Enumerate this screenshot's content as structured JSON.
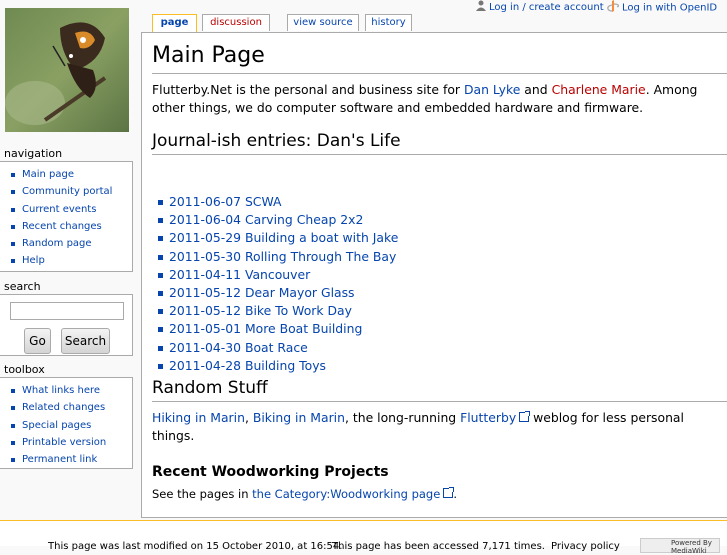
{
  "personal_tools": {
    "login_label": "Log in / create account",
    "openid_label": "Log in with OpenID"
  },
  "tabs": [
    {
      "label": "page"
    },
    {
      "label": "discussion"
    },
    {
      "label": "view source"
    },
    {
      "label": "history"
    }
  ],
  "page": {
    "title": "Main Page",
    "intro": {
      "before": "Flutterby.Net is the personal and business site for ",
      "link1": "Dan Lyke",
      "middle": " and ",
      "link2": "Charlene Marie",
      "after": ". Among other things, we do computer software and embedded hardware and firmware."
    },
    "journal_heading": "Journal-ish entries: Dan's Life",
    "journal_entries": [
      "2011-06-07 SCWA",
      "2011-06-04 Carving Cheap 2x2",
      "2011-05-29 Building a boat with Jake",
      "2011-05-30 Rolling Through The Bay",
      "2011-04-11 Vancouver",
      "2011-05-12 Dear Mayor Glass",
      "2011-05-12 Bike To Work Day",
      "2011-05-01 More Boat Building",
      "2011-04-30 Boat Race",
      "2011-04-28 Building Toys"
    ],
    "random_heading": "Random Stuff",
    "random": {
      "link1": "Hiking in Marin",
      "sep": ", ",
      "link2": "Biking in Marin",
      "middle": ", the long-running ",
      "link3": "Flutterby",
      "after": " weblog for less personal things."
    },
    "woodworking_heading": "Recent Woodworking Projects",
    "woodworking": {
      "before": "See the pages in ",
      "link": "the Category:Woodworking page",
      "after": "."
    }
  },
  "sidebar": {
    "navigation_title": "navigation",
    "navigation": [
      "Main page",
      "Community portal",
      "Current events",
      "Recent changes",
      "Random page",
      "Help"
    ],
    "search_title": "search",
    "search_value": "",
    "go_label": "Go",
    "search_label": "Search",
    "toolbox_title": "toolbox",
    "toolbox": [
      "What links here",
      "Related changes",
      "Special pages",
      "Printable version",
      "Permanent link"
    ]
  },
  "footer": {
    "lastmod": "This page was last modified on 15 October 2010, at 16:54.",
    "viewcount": "This page has been accessed 7,171 times.",
    "privacy": "Privacy policy",
    "poweredby": "Powered By MediaWiki"
  },
  "colors": {
    "link": "#0645ad",
    "new_link": "#ba0000",
    "tab_selected_border": "#fabd23"
  }
}
